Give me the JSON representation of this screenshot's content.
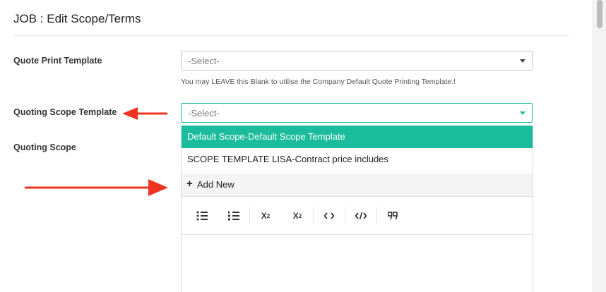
{
  "modal": {
    "title": "JOB : Edit Scope/Terms"
  },
  "form": {
    "quote_print_template": {
      "label": "Quote Print Template",
      "value": "-Select-",
      "help": "You may LEAVE this Blank to utilise the Company Default Quote Printing Template.!"
    },
    "quoting_scope_template": {
      "label": "Quoting Scope Template",
      "value": "-Select-",
      "options": [
        "Default Scope-Default Scope Template",
        "SCOPE TEMPLATE LISA-Contract price includes"
      ],
      "add_new": "Add New"
    },
    "quoting_scope": {
      "label": "Quoting Scope"
    }
  },
  "editor_toolbar": {
    "icons": [
      "bullet-list-icon",
      "numbered-list-icon",
      "subscript-icon",
      "superscript-icon",
      "code-icon",
      "code-block-icon",
      "blockquote-icon"
    ]
  },
  "colors": {
    "accent": "#1abc9c",
    "annotation_arrow": "#ee3322"
  }
}
